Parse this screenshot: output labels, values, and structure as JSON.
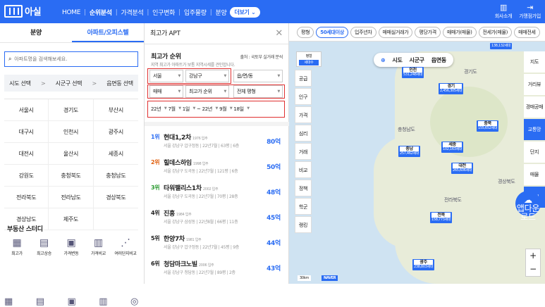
{
  "header": {
    "logo": "아실",
    "nav": [
      "HOME",
      "순위분석",
      "가격분석",
      "인구변화",
      "입주물량",
      "분양"
    ],
    "more": "더보기",
    "right": [
      {
        "icon": "building-icon",
        "label": "회사소개"
      },
      {
        "icon": "login-icon",
        "label": "가맹점가입"
      }
    ]
  },
  "left": {
    "tabs": [
      "분양",
      "아파트/오피스텔"
    ],
    "search_placeholder": "아파트명을 검색해보세요.",
    "region": [
      "시도 선택",
      "시군구 선택",
      "읍면동 선택"
    ],
    "cities": [
      "서울시",
      "경기도",
      "부산시",
      "대구시",
      "인천시",
      "광주시",
      "대전시",
      "울산시",
      "세종시",
      "강원도",
      "충청북도",
      "충청남도",
      "전라북도",
      "전라남도",
      "경상북도",
      "경상남도",
      "제주도",
      ""
    ],
    "study_title": "부동산 스터디",
    "study": [
      "최고가",
      "최고상승",
      "가격변동",
      "가격비교",
      "여러단지비교"
    ]
  },
  "mid": {
    "title": "최고가 APT",
    "rank_title": "최고가 순위",
    "source": "출처 : 국토부 실거래 분석",
    "desc": "지역 최고가 아파트가 보통 지역시세를 견인합니다.",
    "filters": {
      "sido": "서울",
      "sigungu": "강남구",
      "dong": "읍/면/동",
      "type": "매매",
      "order": "최고가 순위",
      "size": "전체 평형"
    },
    "dates": [
      "22년",
      "7월",
      "1일",
      "~",
      "22년",
      "9월",
      "18일"
    ],
    "items": [
      {
        "rank": "1위",
        "name": "현대1,2차",
        "year": "1976 입주",
        "sub": "서울 강남구 압구정동 | 22년7월 | 63평 | 6층",
        "pct": "80억"
      },
      {
        "rank": "2위",
        "name": "힐데스하임",
        "year": "1998 입주",
        "sub": "서울 강남구 도곡동 | 22년7월 | 121평 | 6층",
        "pct": "50억"
      },
      {
        "rank": "3위",
        "name": "타워팰리스1차",
        "year": "2002 입주",
        "sub": "서울 강남구 도곡동 | 22년7월 | 70평 | 28층",
        "pct": "48억"
      },
      {
        "rank": "4위",
        "name": "진흥",
        "year": "1984 입주",
        "sub": "서울 강남구 삼성동 | 22년8월 | 66평 | 11층",
        "pct": "45억"
      },
      {
        "rank": "5위",
        "name": "한양7차",
        "year": "1981 입주",
        "sub": "서울 강남구 압구정동 | 22년7월 | 45평 | 9층",
        "pct": "44억"
      },
      {
        "rank": "6위",
        "name": "청담마크노빌",
        "year": "2006 입주",
        "sub": "서울 강남구 청담동 | 22년7월 | 89평 | 2층",
        "pct": "43억"
      }
    ]
  },
  "map": {
    "chips": [
      "평형",
      "50세대이상",
      "입주년차",
      "매매실거래가",
      "평당가격",
      "매매가(매물)",
      "전세가(매물)",
      "매매전세"
    ],
    "legend": [
      "평형",
      "세대수"
    ],
    "levels": [
      "시도",
      "시군구",
      "읍면동"
    ],
    "side": [
      "공급",
      "인구",
      "가격",
      "심리",
      "거래",
      "비교",
      "정책",
      "학군",
      "랭킹"
    ],
    "rside": [
      "지도",
      "거리뷰",
      "경매공매",
      "교통망",
      "단지",
      "매물",
      "증개"
    ],
    "markers": [
      {
        "name": "인천",
        "val": "531,248세대"
      },
      {
        "name": "경기",
        "val": "2,456,305세대"
      },
      {
        "name": "충북",
        "val": "155,652세대"
      },
      {
        "name": "충남",
        "val": "257,462세대"
      },
      {
        "name": "세종",
        "val": "102,163세대"
      },
      {
        "name": "대전",
        "val": "265,606세대"
      },
      {
        "name": "전북",
        "val": "158,773세대"
      },
      {
        "name": "광주",
        "val": "238,803세대"
      },
      {
        "name": "",
        "val": "138,132세대"
      }
    ],
    "places": [
      "경기도",
      "경상북도",
      "충청남도",
      "전라북도"
    ],
    "download": "앱다운로드",
    "scale": "30km",
    "naver": "NAVER"
  }
}
